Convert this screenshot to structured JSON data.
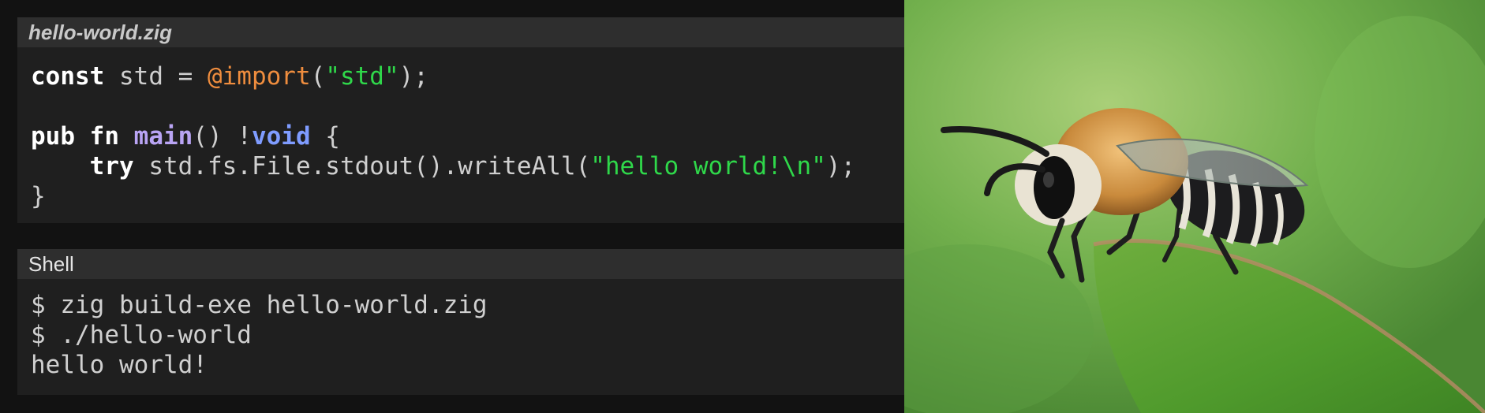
{
  "code_panel": {
    "filename": "hello-world.zig",
    "lines": [
      [
        {
          "t": "const",
          "c": "kw"
        },
        {
          "t": " std = ",
          "c": ""
        },
        {
          "t": "@import",
          "c": "builtin"
        },
        {
          "t": "(",
          "c": ""
        },
        {
          "t": "\"std\"",
          "c": "str"
        },
        {
          "t": ");",
          "c": ""
        }
      ],
      [],
      [
        {
          "t": "pub",
          "c": "kw"
        },
        {
          "t": " ",
          "c": ""
        },
        {
          "t": "fn",
          "c": "kw"
        },
        {
          "t": " ",
          "c": ""
        },
        {
          "t": "main",
          "c": "fn"
        },
        {
          "t": "() !",
          "c": ""
        },
        {
          "t": "void",
          "c": "type"
        },
        {
          "t": " {",
          "c": ""
        }
      ],
      [
        {
          "t": "    ",
          "c": ""
        },
        {
          "t": "try",
          "c": "kw"
        },
        {
          "t": " std.fs.File.stdout().writeAll(",
          "c": ""
        },
        {
          "t": "\"hello world!\\n\"",
          "c": "str"
        },
        {
          "t": ");",
          "c": ""
        }
      ],
      [
        {
          "t": "}",
          "c": ""
        }
      ]
    ]
  },
  "shell_panel": {
    "title": "Shell",
    "lines": [
      "$ zig build-exe hello-world.zig",
      "$ ./hello-world",
      "hello world!"
    ]
  },
  "photo": {
    "subject": "bee-on-leaf-photo"
  },
  "colors": {
    "keyword": "#ffffff",
    "builtin": "#ef8d3e",
    "string": "#2fd84a",
    "function": "#b9a4f4",
    "type": "#7f9cff"
  }
}
